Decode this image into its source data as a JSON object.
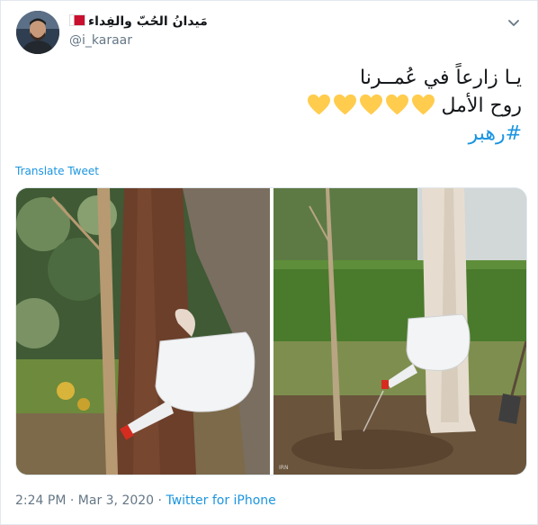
{
  "author": {
    "display_name": "مَيدانُ الحُبّ والفِداء",
    "handle": "@i_karaar",
    "flag_icon": "bahrain-flag-icon"
  },
  "tweet": {
    "line1": "يـا زارعاً في عُمــرنا",
    "line2": "روح الأمل",
    "heart_count": 5,
    "heart_color": "#ffcc4d",
    "hashtag": "#رهبر"
  },
  "translate_label": "Translate Tweet",
  "meta": {
    "time": "2:24 PM",
    "separator": "·",
    "date": "Mar 3, 2020",
    "source": "Twitter for iPhone"
  },
  "colors": {
    "link": "#1b95e0",
    "secondary_text": "#657786",
    "border": "#e1e8ed"
  }
}
